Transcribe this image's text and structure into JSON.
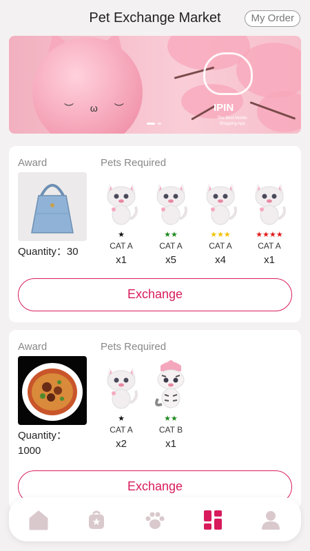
{
  "header": {
    "title": "Pet Exchange Market",
    "my_order": "My Order"
  },
  "banner": {
    "brand": "IPIN",
    "tagline": "The Best Mobile Shopping App"
  },
  "cards": [
    {
      "award_label": "Award",
      "pets_label": "Pets Required",
      "award_icon": "blue-handbag",
      "quantity": "Quantity：30",
      "pets": [
        {
          "name": "CAT A",
          "stars": "★",
          "star_color": "#111111",
          "count": "x1"
        },
        {
          "name": "CAT A",
          "stars": "★★",
          "star_color": "#1e8a1e",
          "count": "x5"
        },
        {
          "name": "CAT A",
          "stars": "★★★",
          "star_color": "#f2c200",
          "count": "x4"
        },
        {
          "name": "CAT A",
          "stars": "★★★★",
          "star_color": "#e01b1b",
          "count": "x1"
        }
      ],
      "button": "Exchange"
    },
    {
      "award_label": "Award",
      "pets_label": "Pets Required",
      "award_icon": "noodle-bowl",
      "quantity": "Quantity：\n1000",
      "pets": [
        {
          "name": "CAT A",
          "stars": "★",
          "star_color": "#111111",
          "count": "x2"
        },
        {
          "name": "CAT B",
          "stars": "★★",
          "star_color": "#1e8a1e",
          "count": "x1"
        }
      ],
      "button": "Exchange"
    }
  ],
  "tabbar": {
    "items": [
      {
        "icon": "home-icon",
        "active": false
      },
      {
        "icon": "shop-bag-icon",
        "active": false
      },
      {
        "icon": "paw-icon",
        "active": false
      },
      {
        "icon": "grid-icon",
        "active": true
      },
      {
        "icon": "profile-icon",
        "active": false
      }
    ],
    "active_color": "#d81b5c",
    "inactive_color": "#c9b9bd"
  }
}
